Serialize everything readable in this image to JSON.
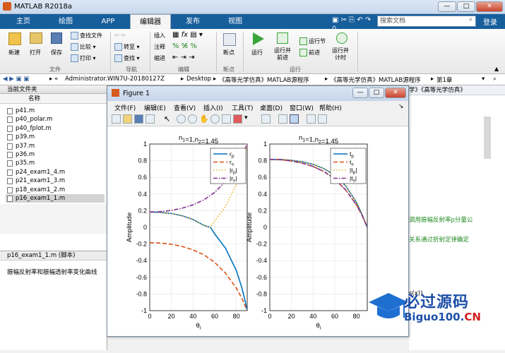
{
  "window": {
    "title": "MATLAB R2018a",
    "min": "—",
    "max": "□",
    "close": "✕"
  },
  "tabs": [
    "主页",
    "绘图",
    "APP",
    "编辑器",
    "发布",
    "视图"
  ],
  "search_placeholder": "搜索文档",
  "login": "登录",
  "ribbon": {
    "new": "新建",
    "open": "打开",
    "save": "保存",
    "find_files": "查找文件",
    "compare": "比较",
    "print": "打印",
    "goto": "转至",
    "find": "查找",
    "insert": "插入",
    "comment": "注释",
    "indent": "缩进",
    "breakpoints": "断点",
    "run": "运行",
    "run_advance": "运行并\n前进",
    "run_section": "运行节",
    "advance": "前进",
    "run_time": "运行并\n计时",
    "groups": {
      "file": "文件",
      "nav": "导航",
      "edit": "编辑",
      "bp": "断点",
      "run": "运行"
    }
  },
  "path": [
    "Administrator.WIN7U-20180127Z",
    "Desktop",
    "《高等光学仿真》MATLAB源程序",
    "《高等光学仿真》MATLAB源程序",
    "第1章"
  ],
  "left_panel": {
    "title": "当前文件夹",
    "col": "名称",
    "files": [
      "p41.m",
      "p40_polar.m",
      "p40_fplot.m",
      "p39.m",
      "p37.m",
      "p36.m",
      "p35.m",
      "p24_exam1_4.m",
      "p21_exam1_3.m",
      "p18_exam1_2.m",
      "p16_exam1_1.m"
    ],
    "selected": 10,
    "detail_title": "p16_exam1_1.m  (脚本)",
    "detail_desc": "振幅反射率和振幅透射率变化曲线"
  },
  "figure": {
    "title": "Figure 1",
    "menus": [
      "文件(F)",
      "编辑(E)",
      "查看(V)",
      "插入(I)",
      "工具(T)",
      "桌面(D)",
      "窗口(W)",
      "帮助(H)"
    ]
  },
  "chart_data": [
    {
      "type": "line",
      "title": "n1=1,n2=1.45",
      "xlabel": "θi",
      "ylabel": "Amplitude",
      "xlim": [
        0,
        90
      ],
      "ylim": [
        -1,
        1
      ],
      "xticks": [
        0,
        20,
        40,
        60,
        80
      ],
      "yticks": [
        -1,
        -0.8,
        -0.6,
        -0.4,
        -0.2,
        0,
        0.2,
        0.4,
        0.6,
        0.8,
        1
      ],
      "legend": "top-right",
      "series": [
        {
          "name": "rp",
          "color": "#0072bd",
          "style": "solid",
          "x": [
            0,
            10,
            20,
            30,
            40,
            50,
            56,
            60,
            70,
            80,
            85,
            88,
            90
          ],
          "y": [
            0.184,
            0.18,
            0.166,
            0.139,
            0.094,
            0.024,
            0,
            -0.08,
            -0.25,
            -0.52,
            -0.72,
            -0.88,
            -1.0
          ]
        },
        {
          "name": "rs",
          "color": "#d95319",
          "style": "dash",
          "x": [
            0,
            10,
            20,
            30,
            40,
            50,
            60,
            70,
            80,
            85,
            88,
            90
          ],
          "y": [
            -0.184,
            -0.188,
            -0.203,
            -0.23,
            -0.27,
            -0.33,
            -0.42,
            -0.55,
            -0.73,
            -0.85,
            -0.94,
            -1.0
          ]
        },
        {
          "name": "|rp|",
          "color": "#edb120",
          "style": "dot",
          "x": [
            0,
            10,
            20,
            30,
            40,
            50,
            56,
            60,
            70,
            80,
            85,
            88,
            90
          ],
          "y": [
            0.184,
            0.18,
            0.166,
            0.139,
            0.094,
            0.024,
            0,
            0.08,
            0.25,
            0.52,
            0.72,
            0.88,
            1.0
          ]
        },
        {
          "name": "|rs|",
          "color": "#7e2f8e",
          "style": "dashdot",
          "x": [
            0,
            10,
            20,
            30,
            40,
            50,
            60,
            70,
            80,
            85,
            88,
            90
          ],
          "y": [
            0.184,
            0.188,
            0.203,
            0.23,
            0.27,
            0.33,
            0.42,
            0.55,
            0.73,
            0.85,
            0.94,
            1.0
          ]
        }
      ]
    },
    {
      "type": "line",
      "title": "n1=1,n2=1.45",
      "xlabel": "θi",
      "ylabel": "Amplitude",
      "xlim": [
        0,
        90
      ],
      "ylim": [
        -1,
        1
      ],
      "xticks": [
        0,
        20,
        40,
        60,
        80
      ],
      "yticks": [
        -1,
        -0.8,
        -0.6,
        -0.4,
        -0.2,
        0,
        0.2,
        0.4,
        0.6,
        0.8,
        1
      ],
      "legend": "top-right",
      "series": [
        {
          "name": "tp",
          "color": "#0072bd",
          "style": "solid",
          "x": [
            0,
            10,
            20,
            30,
            40,
            50,
            60,
            70,
            80,
            85,
            90
          ],
          "y": [
            0.816,
            0.814,
            0.805,
            0.787,
            0.756,
            0.705,
            0.625,
            0.5,
            0.3,
            0.16,
            0
          ]
        },
        {
          "name": "ts",
          "color": "#d95319",
          "style": "dash",
          "x": [
            0,
            10,
            20,
            30,
            40,
            50,
            60,
            70,
            80,
            85,
            90
          ],
          "y": [
            0.816,
            0.812,
            0.797,
            0.77,
            0.73,
            0.67,
            0.58,
            0.45,
            0.27,
            0.15,
            0
          ]
        },
        {
          "name": "|tp|",
          "color": "#edb120",
          "style": "dot",
          "x": [
            0,
            10,
            20,
            30,
            40,
            50,
            60,
            70,
            80,
            85,
            90
          ],
          "y": [
            0.816,
            0.814,
            0.805,
            0.787,
            0.756,
            0.705,
            0.625,
            0.5,
            0.3,
            0.16,
            0
          ]
        },
        {
          "name": "|ts|",
          "color": "#7e2f8e",
          "style": "dashdot",
          "x": [
            0,
            10,
            20,
            30,
            40,
            50,
            60,
            70,
            80,
            85,
            90
          ],
          "y": [
            0.816,
            0.812,
            0.797,
            0.77,
            0.73,
            0.67,
            0.58,
            0.45,
            0.27,
            0.15,
            0
          ]
        }
      ]
    }
  ],
  "right_panel": {
    "crumb": "学》《高等光学仿真》",
    "line1": "调用振幅反射率p分量公",
    "line2": "关系通过折射定律确定",
    "line3": "s(x))"
  },
  "watermark": "必过源码 Biguo100.CN"
}
